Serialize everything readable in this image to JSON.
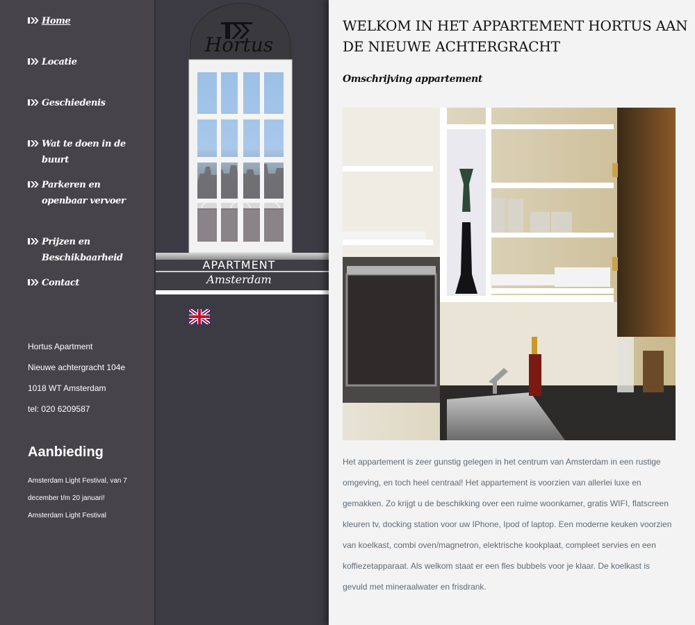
{
  "nav": {
    "items": [
      {
        "label": "Home",
        "active": true
      },
      {
        "label": "Locatie"
      },
      {
        "label": "Geschiedenis"
      },
      {
        "label": "Wat te doen in de buurt"
      },
      {
        "label": "Parkeren en openbaar vervoer"
      },
      {
        "label": "Prijzen en Beschikbaarheid"
      },
      {
        "label": "Contact"
      }
    ]
  },
  "address": {
    "name": "Hortus Apartment",
    "street": "Nieuwe achtergracht 104e",
    "city": "1018 WT Amsterdam",
    "phone": "tel: 020 6209587"
  },
  "offer": {
    "title": "Aanbieding",
    "text": "Amsterdam Light Festival, van 7 december t/m 20 januari!",
    "link": "Amsterdam Light Festival"
  },
  "logo": {
    "brand": "Hortus",
    "line1": "APARTMENT",
    "line2": "Amsterdam"
  },
  "language": {
    "flag": "uk-flag-icon"
  },
  "main": {
    "title": "WELKOM IN HET APPARTEMENT HORTUS AAN DE NIEUWE ACHTERGRACHT",
    "subtitle": "Omschrijving appartement",
    "description": "Het appartement is zeer gunstig gelegen in het centrum van Amsterdam in een rustige omgeving, en toch heel centraal! Het appartement is voorzien van allerlei luxe en gemakken. Zo krijgt u de beschikking over een ruime woonkamer, gratis WIFI, flatscreen kleuren tv, docking station voor uw IPhone, Ipod of laptop.  Een moderne keuken voorzien van koelkast, combi oven/magnetron, elektrische kookplaat, compleet servies en een koffiezetapparaat. Als welkom staat er een fles bubbels voor je klaar. De koelkast is gevuld met mineraalwater en frisdrank."
  },
  "colors": {
    "sidebar": "#464449",
    "center": "#3c3b44",
    "content": "#f3f3f3",
    "body_text": "#5e6a74"
  }
}
